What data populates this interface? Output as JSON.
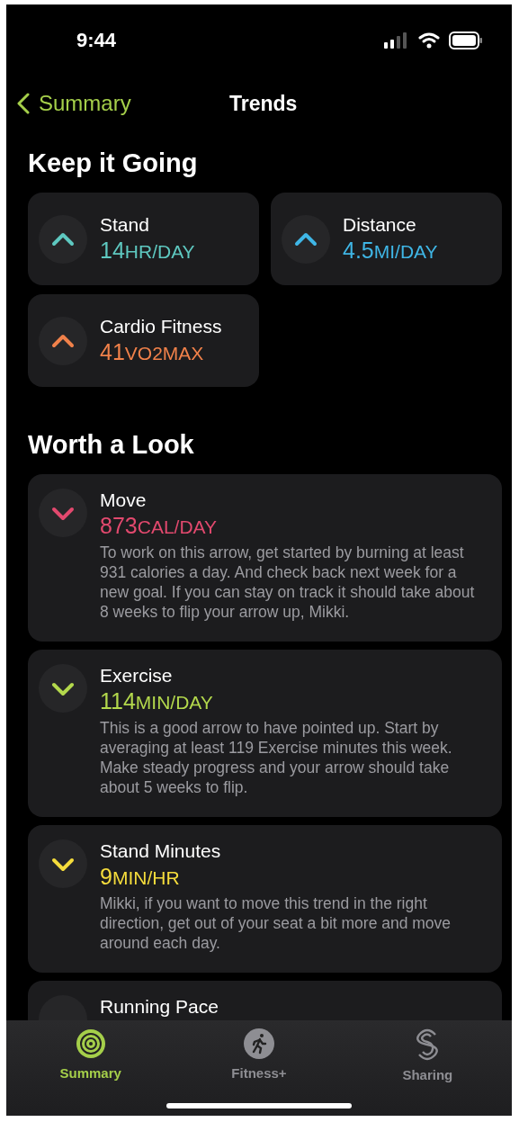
{
  "status_bar": {
    "time": "9:44"
  },
  "nav": {
    "back": "Summary",
    "title": "Trends"
  },
  "sections": [
    {
      "title": "Keep it Going",
      "kind": "grid",
      "items": [
        {
          "name": "Stand",
          "value": "14",
          "unit": "HR/DAY",
          "kind": "up",
          "color": "#5ec8c0"
        },
        {
          "name": "Distance",
          "value": "4.5",
          "unit": "MI/DAY",
          "kind": "up",
          "color": "#3fb6e6"
        },
        {
          "name": "Cardio Fitness",
          "value": "41",
          "unit": "VO2MAX",
          "kind": "up",
          "color": "#f0814a"
        }
      ]
    },
    {
      "title": "Worth a Look",
      "kind": "list",
      "items": [
        {
          "name": "Move",
          "value": "873",
          "unit": "CAL/DAY",
          "kind": "down",
          "color": "#e2496e",
          "text": "To work on this arrow, get started by burning at least 931 calories a day. And check back next week for a new goal. If you can stay on track it should take about 8 weeks to flip your arrow up, Mikki."
        },
        {
          "name": "Exercise",
          "value": "114",
          "unit": "MIN/DAY",
          "kind": "down",
          "color": "#b3d84c",
          "text": "This is a good arrow to have pointed up. Start by averaging at least 119 Exercise minutes this week. Make steady progress and your arrow should take about 5 weeks to flip."
        },
        {
          "name": "Stand Minutes",
          "value": "9",
          "unit": "MIN/HR",
          "kind": "down",
          "color": "#f5dc3c",
          "text": "Mikki, if you want to move this trend in the right direction, get out of your seat a bit more and move around each day."
        },
        {
          "name": "Running Pace"
        }
      ]
    }
  ],
  "tabs": [
    {
      "label": "Summary",
      "kind": "rings",
      "selected": true
    },
    {
      "label": "Fitness+",
      "kind": "runner",
      "selected": false
    },
    {
      "label": "Sharing",
      "kind": "loop",
      "selected": false
    }
  ]
}
